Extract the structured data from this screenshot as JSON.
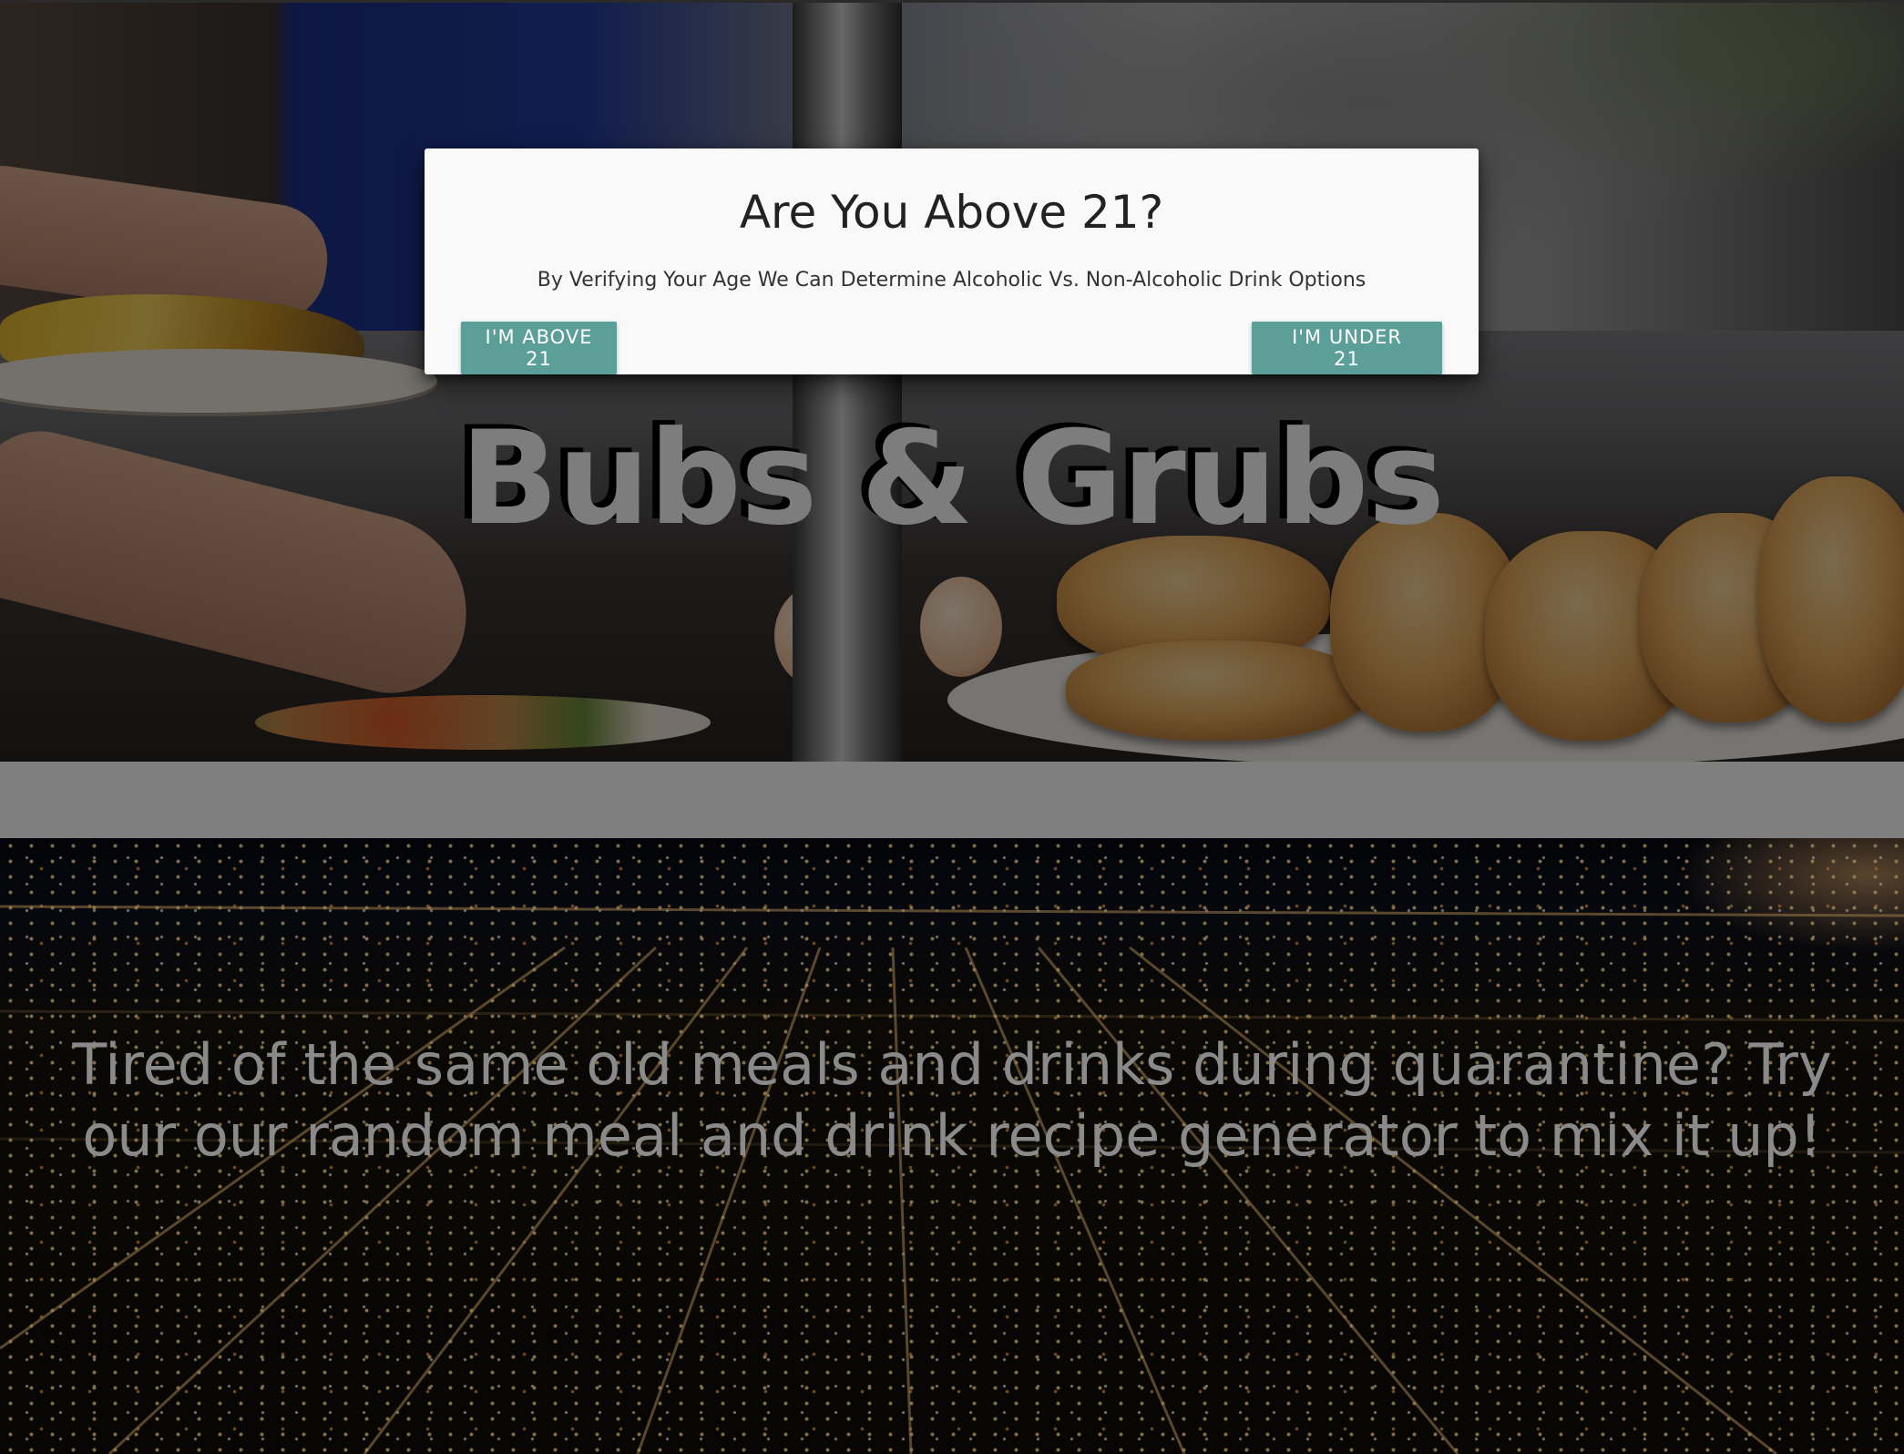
{
  "hero": {
    "brand_title": "Bubs & Grubs"
  },
  "intro": {
    "tagline": "Tired of the same old meals and drinks during quarantine? Try our our random meal and drink recipe generator to mix it up!"
  },
  "age_modal": {
    "title": "Are You Above 21?",
    "description": "By Verifying Your Age We Can Determine Alcoholic Vs. Non-Alcoholic Drink Options",
    "above_button_label": "I'M ABOVE 21",
    "under_button_label": "I'M UNDER 21"
  },
  "colors": {
    "button": "#5b9f98",
    "modal_background": "#f9f9f9",
    "band": "#7f7f7f"
  }
}
